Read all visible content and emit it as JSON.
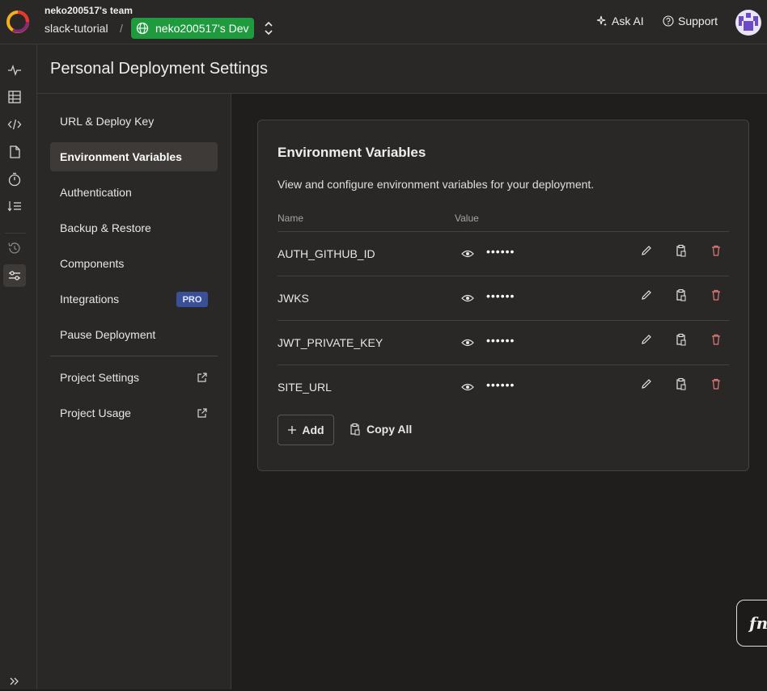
{
  "topbar": {
    "team_name": "neko200517's team",
    "project_name": "slack-tutorial",
    "separator": "/",
    "deployment_name": "neko200517's Dev",
    "ask_ai_label": "Ask AI",
    "support_label": "Support"
  },
  "page": {
    "title": "Personal Deployment Settings"
  },
  "settings_nav": {
    "items": [
      {
        "label": "URL & Deploy Key"
      },
      {
        "label": "Environment Variables",
        "active": true
      },
      {
        "label": "Authentication"
      },
      {
        "label": "Backup & Restore"
      },
      {
        "label": "Components"
      },
      {
        "label": "Integrations",
        "badge": "PRO"
      },
      {
        "label": "Pause Deployment"
      }
    ],
    "links": [
      {
        "label": "Project Settings"
      },
      {
        "label": "Project Usage"
      }
    ]
  },
  "env_card": {
    "title": "Environment Variables",
    "description": "View and configure environment variables for your deployment.",
    "col_name": "Name",
    "col_value": "Value",
    "rows": [
      {
        "name": "AUTH_GITHUB_ID",
        "value_masked": "••••••"
      },
      {
        "name": "JWKS",
        "value_masked": "••••••"
      },
      {
        "name": "JWT_PRIVATE_KEY",
        "value_masked": "••••••"
      },
      {
        "name": "SITE_URL",
        "value_masked": "••••••"
      }
    ],
    "add_label": "Add",
    "copy_all_label": "Copy All"
  },
  "fn_button": {
    "label": "fn"
  },
  "colors": {
    "accent_green": "#1f9a3e",
    "pro_badge": "#3a4f96",
    "delete_icon": "#e07a7a"
  }
}
